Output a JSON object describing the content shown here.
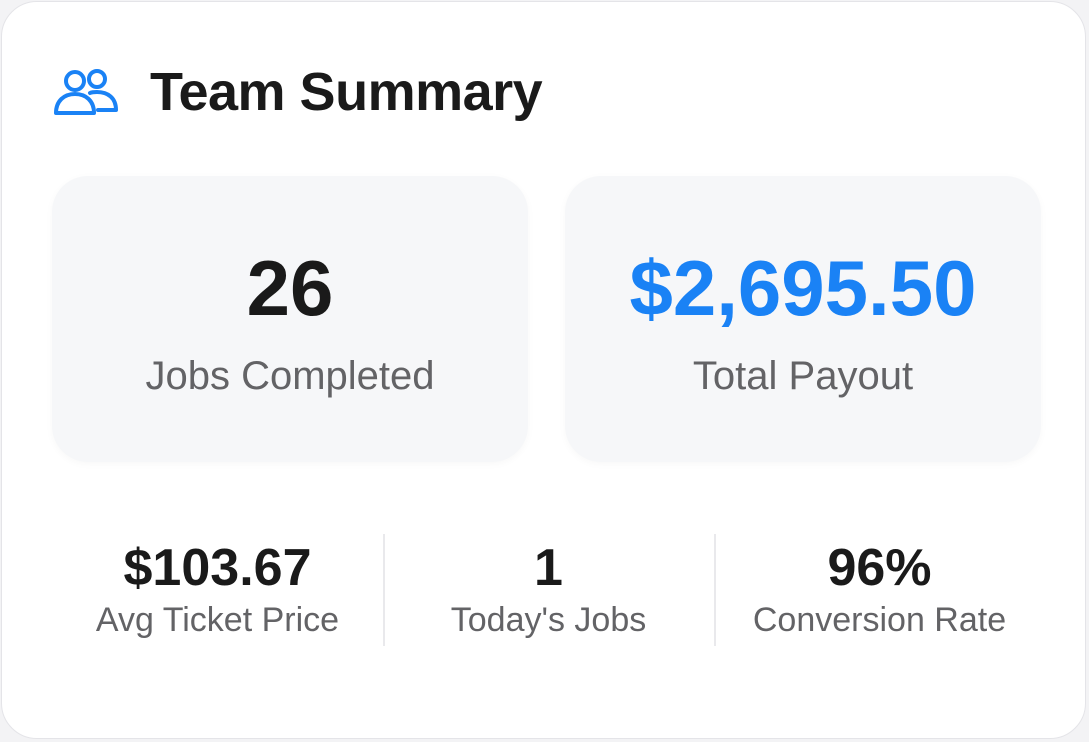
{
  "header": {
    "title": "Team Summary",
    "icon": "team-icon",
    "icon_color": "#1a82f5"
  },
  "tiles": [
    {
      "value": "26",
      "label": "Jobs Completed"
    },
    {
      "value": "$2,695.50",
      "label": "Total Payout",
      "value_color": "#1a82f5"
    }
  ],
  "stats": [
    {
      "value": "$103.67",
      "label": "Avg Ticket Price"
    },
    {
      "value": "1",
      "label": "Today's Jobs"
    },
    {
      "value": "96%",
      "label": "Conversion Rate"
    }
  ]
}
